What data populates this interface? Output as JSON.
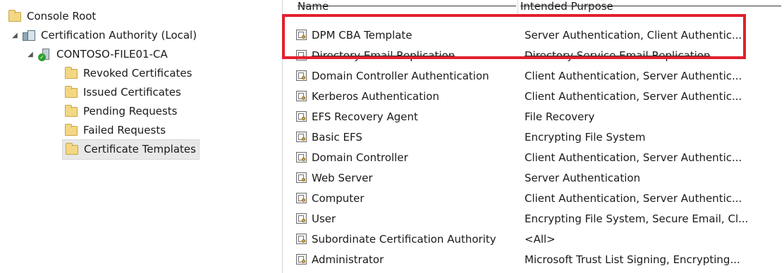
{
  "tree": {
    "root": {
      "label": "Console Root",
      "icon": "folder-icon"
    },
    "authority": {
      "label": "Certification Authority (Local)",
      "icon": "certificate-authority-icon",
      "expanded": true
    },
    "server": {
      "label": "CONTOSO-FILE01-CA",
      "icon": "ca-server-icon",
      "expanded": true
    },
    "folders": [
      {
        "label": "Revoked Certificates",
        "icon": "folder-icon"
      },
      {
        "label": "Issued Certificates",
        "icon": "folder-icon"
      },
      {
        "label": "Pending Requests",
        "icon": "folder-icon"
      },
      {
        "label": "Failed Requests",
        "icon": "folder-icon"
      },
      {
        "label": "Certificate Templates",
        "icon": "folder-icon",
        "selected": true
      }
    ]
  },
  "list": {
    "columns": {
      "name": "Name",
      "purpose": "Intended Purpose"
    },
    "rows": [
      {
        "name": "DPM CBA Template",
        "purpose": "Server Authentication, Client Authentic...",
        "icon": "template-icon"
      },
      {
        "name": "Directory Email Replication",
        "purpose": "Directory Service Email Replication",
        "icon": "template-icon"
      },
      {
        "name": "Domain Controller Authentication",
        "purpose": "Client Authentication, Server Authentic...",
        "icon": "template-icon"
      },
      {
        "name": "Kerberos Authentication",
        "purpose": "Client Authentication, Server Authentic...",
        "icon": "template-icon"
      },
      {
        "name": "EFS Recovery Agent",
        "purpose": "File Recovery",
        "icon": "template-icon"
      },
      {
        "name": "Basic EFS",
        "purpose": "Encrypting File System",
        "icon": "template-icon"
      },
      {
        "name": "Domain Controller",
        "purpose": "Client Authentication, Server Authentic...",
        "icon": "template-icon"
      },
      {
        "name": "Web Server",
        "purpose": "Server Authentication",
        "icon": "template-icon"
      },
      {
        "name": "Computer",
        "purpose": "Client Authentication, Server Authentic...",
        "icon": "template-icon"
      },
      {
        "name": "User",
        "purpose": "Encrypting File System, Secure Email, Cl...",
        "icon": "template-icon"
      },
      {
        "name": "Subordinate Certification Authority",
        "purpose": "<All>",
        "icon": "template-icon"
      },
      {
        "name": "Administrator",
        "purpose": "Microsoft Trust List Signing, Encrypting...",
        "icon": "template-icon"
      }
    ]
  },
  "colors": {
    "highlight": "#e2202e",
    "folder": "#f3d782",
    "selection": "#e8e8e8",
    "check": "#2aa12a"
  }
}
